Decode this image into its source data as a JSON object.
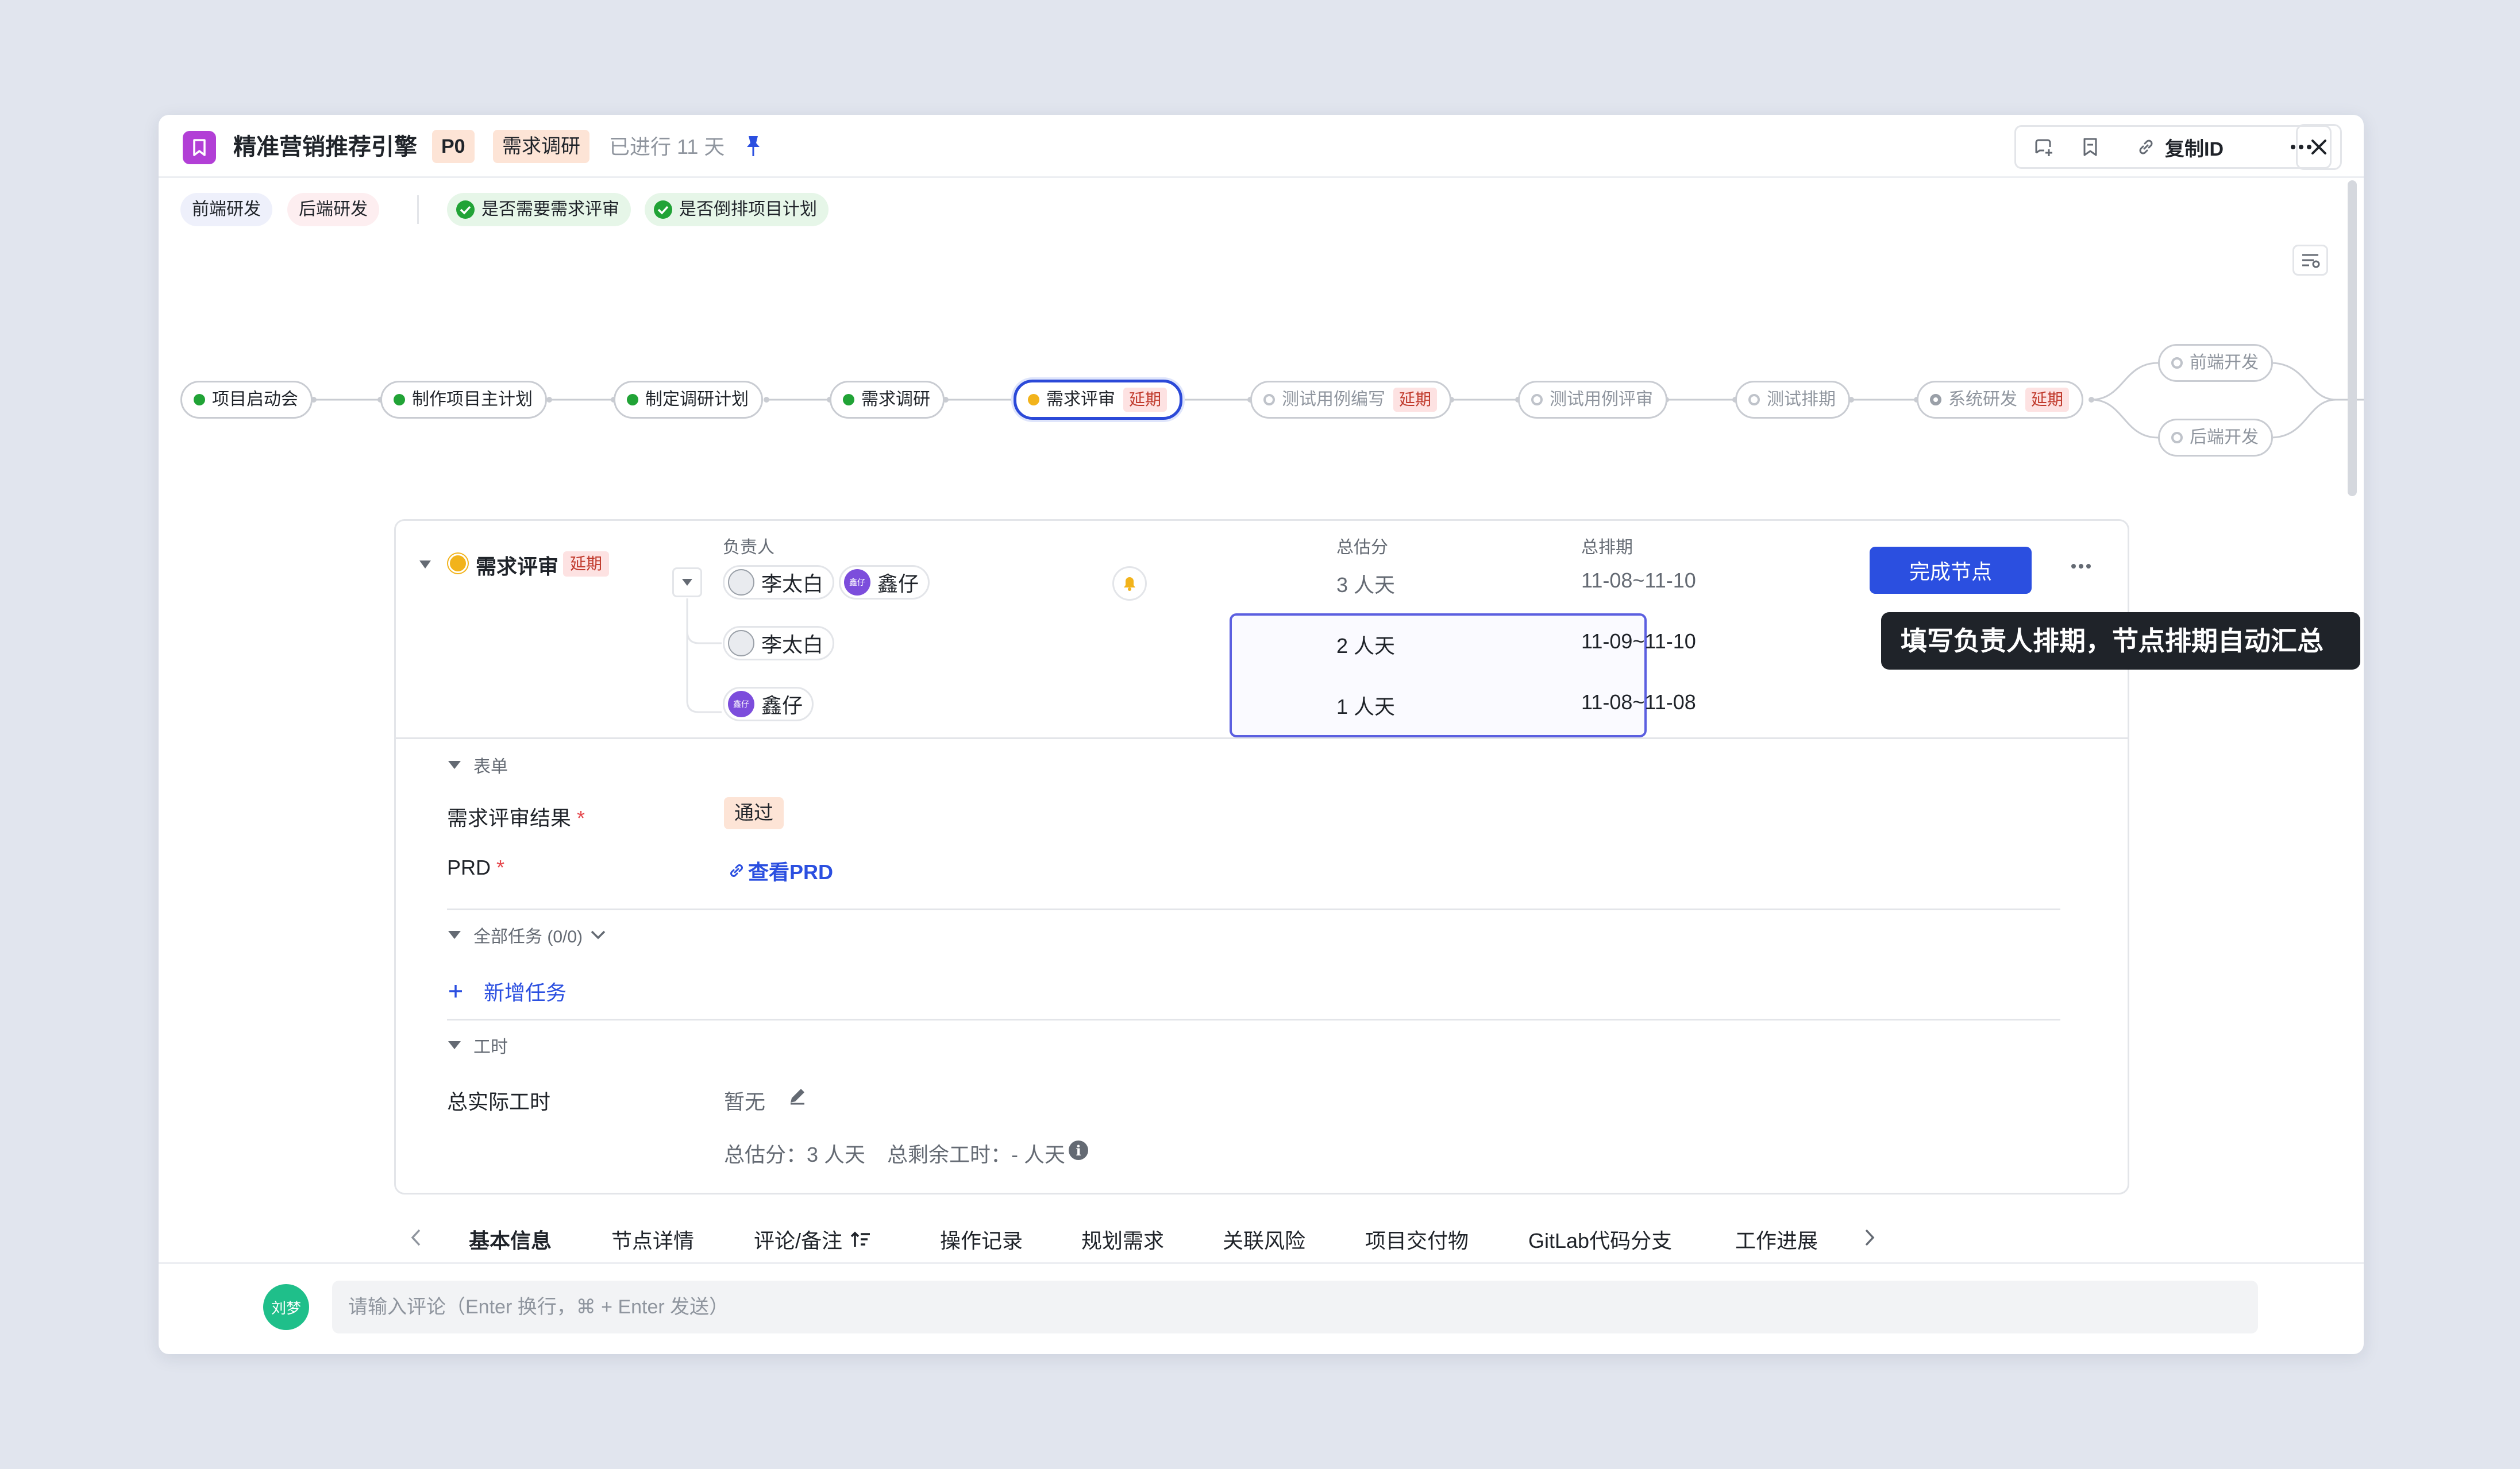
{
  "header": {
    "title": "精准营销推荐引擎",
    "priority": "P0",
    "stage": "需求调研",
    "elapsed": "已进行 11 天",
    "copy_id": "复制ID"
  },
  "tags": [
    "前端研发",
    "后端研发"
  ],
  "checks": [
    "是否需要需求评审",
    "是否倒排项目计划"
  ],
  "flow": {
    "nodes": [
      {
        "label": "项目启动会"
      },
      {
        "label": "制作项目主计划"
      },
      {
        "label": "制定调研计划"
      },
      {
        "label": "需求调研"
      },
      {
        "label": "需求评审",
        "badge": "延期"
      },
      {
        "label": "测试用例编写",
        "badge": "延期"
      },
      {
        "label": "测试用例评审"
      },
      {
        "label": "测试排期"
      },
      {
        "label": "系统研发",
        "badge": "延期"
      },
      {
        "label": "前端开发"
      },
      {
        "label": "后端开发"
      }
    ]
  },
  "node_detail": {
    "name": "需求评审",
    "badge": "延期",
    "owner_label": "负责人",
    "estimate_label": "总估分",
    "schedule_label": "总排期",
    "total_estimate": "3 人天",
    "total_schedule": "11-08~11-10",
    "owners": [
      "李太白",
      "鑫仔"
    ],
    "avatar_x": "鑫仔",
    "rows": [
      {
        "name": "李太白",
        "estimate": "2 人天",
        "schedule": "11-09~11-10"
      },
      {
        "name": "鑫仔",
        "estimate": "1 人天",
        "schedule": "11-08~11-08"
      }
    ],
    "complete_button": "完成节点",
    "tooltip": "填写负责人排期，节点排期自动汇总"
  },
  "form": {
    "section": "表单",
    "review_result_label": "需求评审结果",
    "review_result": "通过",
    "prd_label": "PRD",
    "prd_link": "查看PRD",
    "required_mark": "*"
  },
  "tasks": {
    "section": "全部任务 (0/0)",
    "add": "新增任务"
  },
  "worktime": {
    "section": "工时",
    "actual_label": "总实际工时",
    "actual_value": "暂无",
    "summary_estimate": "总估分：3 人天",
    "summary_remaining": "总剩余工时：- 人天"
  },
  "tabs": [
    "基本信息",
    "节点详情",
    "评论/备注",
    "操作记录",
    "规划需求",
    "关联风险",
    "项目交付物",
    "GitLab代码分支",
    "工作进展"
  ],
  "comment": {
    "user": "刘梦",
    "placeholder": "请输入评论（Enter 换行，⌘ + Enter 发送）"
  },
  "colors": {
    "accent": "#2b4fe0",
    "done": "#21a336",
    "current": "#f2b31b",
    "delay_bg": "#fde2e2",
    "delay_text": "#c0392b",
    "logo": "#b23fd6"
  }
}
